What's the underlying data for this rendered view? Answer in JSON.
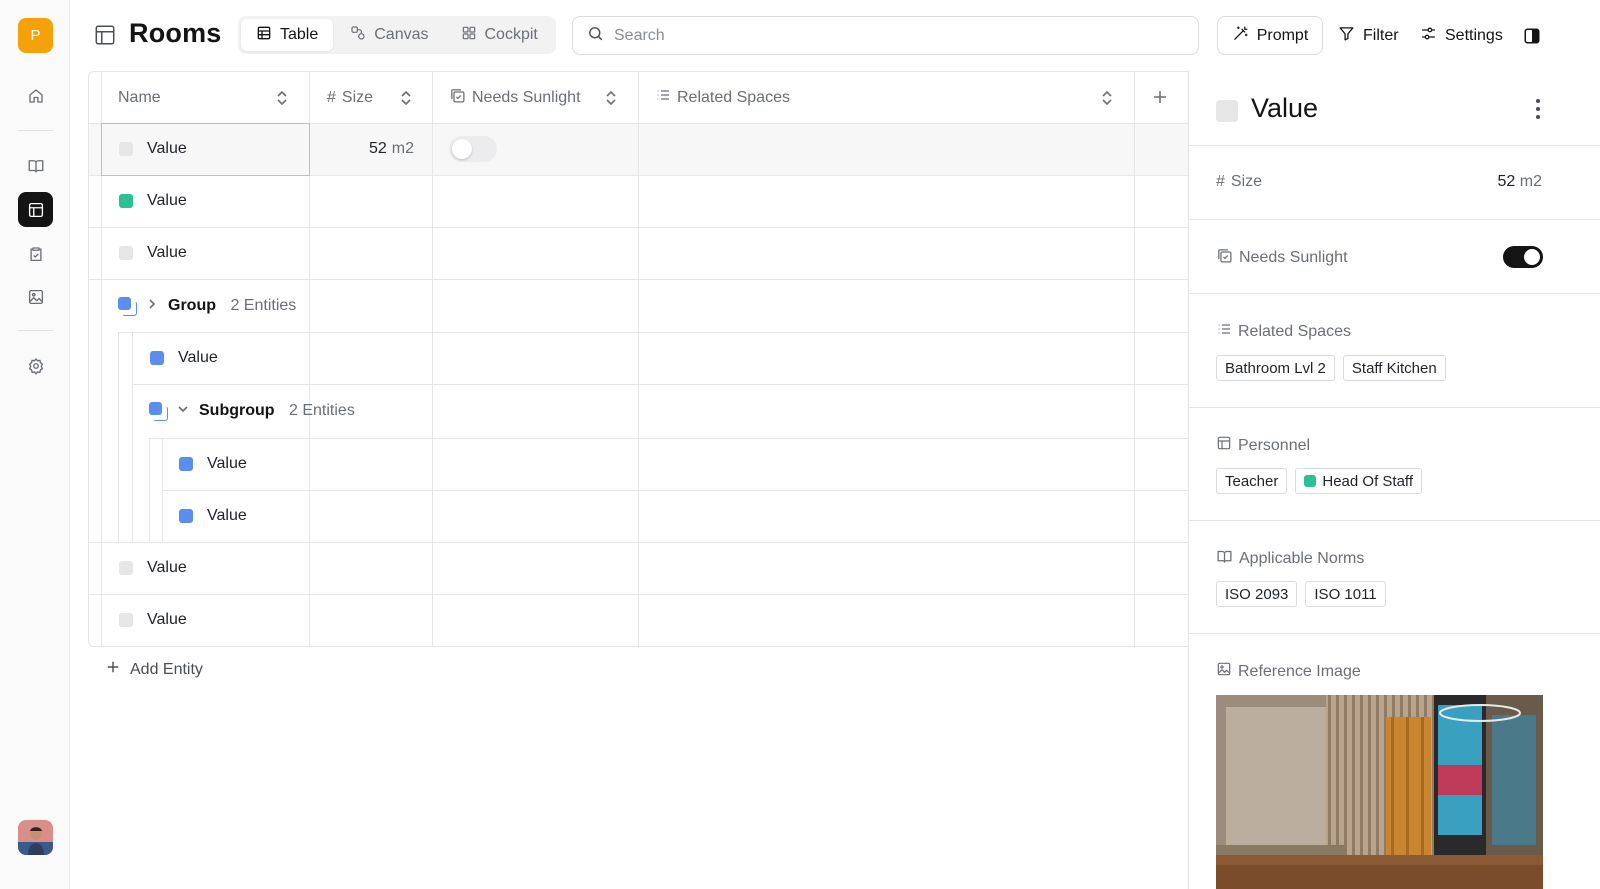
{
  "app": {
    "logo_letter": "P"
  },
  "header": {
    "title": "Rooms",
    "views": [
      {
        "label": "Table",
        "active": true
      },
      {
        "label": "Canvas",
        "active": false
      },
      {
        "label": "Cockpit",
        "active": false
      }
    ],
    "search_placeholder": "Search",
    "prompt_label": "Prompt",
    "filter_label": "Filter",
    "settings_label": "Settings"
  },
  "table": {
    "columns": [
      "Name",
      "Size",
      "Needs Sunlight",
      "Related Spaces"
    ],
    "rows": [
      {
        "name": "Value",
        "color": "#e6e6e6",
        "size": "52",
        "size_unit": "m2",
        "needs_sunlight": false
      },
      {
        "name": "Value",
        "color": "#2cc194"
      },
      {
        "name": "Value",
        "color": "#e6e6e6"
      }
    ],
    "group": {
      "label": "Group",
      "count": "2 Entities",
      "rows": [
        {
          "name": "Value",
          "color": "#5b8def"
        }
      ],
      "subgroup": {
        "label": "Subgroup",
        "count": "2 Entities",
        "rows": [
          {
            "name": "Value",
            "color": "#5b8def"
          },
          {
            "name": "Value",
            "color": "#5b8def"
          }
        ]
      }
    },
    "rows_after": [
      {
        "name": "Value",
        "color": "#e6e6e6"
      },
      {
        "name": "Value",
        "color": "#e6e6e6"
      }
    ],
    "add_entity_label": "Add Entity"
  },
  "panel": {
    "title": "Value",
    "size_label": "Size",
    "size_value": "52",
    "size_unit": "m2",
    "needs_sunlight_label": "Needs Sunlight",
    "needs_sunlight_value": true,
    "related_spaces_label": "Related Spaces",
    "related_spaces": [
      "Bathroom Lvl 2",
      "Staff Kitchen"
    ],
    "personnel_label": "Personnel",
    "personnel": [
      {
        "label": "Teacher"
      },
      {
        "label": "Head Of Staff",
        "color": "#2cc194"
      }
    ],
    "applicable_norms_label": "Applicable Norms",
    "applicable_norms": [
      "ISO 2093",
      "ISO 1011"
    ],
    "reference_image_label": "Reference Image"
  },
  "colors": {
    "accent": "#f5a20a",
    "blue": "#5b8def",
    "green": "#2cc194",
    "selection": "#f0b46a"
  }
}
